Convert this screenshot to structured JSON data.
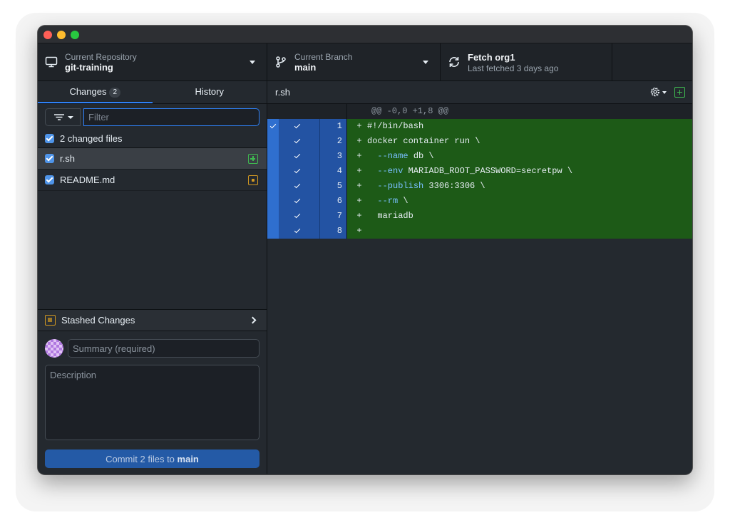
{
  "toolbar": {
    "repo_label": "Current Repository",
    "repo_value": "git-training",
    "branch_label": "Current Branch",
    "branch_value": "main",
    "fetch_label": "Fetch org1",
    "fetch_sub": "Last fetched 3 days ago"
  },
  "tabs": {
    "changes_label": "Changes",
    "changes_count": "2",
    "history_label": "History"
  },
  "filter": {
    "placeholder": "Filter"
  },
  "changes": {
    "summary": "2 changed files",
    "files": [
      {
        "name": "r.sh",
        "status": "added",
        "checked": true
      },
      {
        "name": "README.md",
        "status": "modified",
        "checked": true
      }
    ]
  },
  "stash": {
    "label": "Stashed Changes"
  },
  "commit": {
    "summary_placeholder": "Summary (required)",
    "description_placeholder": "Description",
    "button_prefix": "Commit 2 files to ",
    "button_branch": "main"
  },
  "diff": {
    "file_name": "r.sh",
    "hunk_header": "@@ -0,0 +1,8 @@",
    "lines": [
      {
        "num": "1",
        "sign": "+",
        "code": "#!/bin/bash"
      },
      {
        "num": "2",
        "sign": "+",
        "code": "docker container run \\"
      },
      {
        "num": "3",
        "sign": "+",
        "code": "  --name db \\"
      },
      {
        "num": "4",
        "sign": "+",
        "code": "  --env MARIADB_ROOT_PASSWORD=secretpw \\"
      },
      {
        "num": "5",
        "sign": "+",
        "code": "  --publish 3306:3306 \\"
      },
      {
        "num": "6",
        "sign": "+",
        "code": "  --rm \\"
      },
      {
        "num": "7",
        "sign": "+",
        "code": "  mariadb"
      },
      {
        "num": "8",
        "sign": "+",
        "code": ""
      }
    ]
  },
  "colors": {
    "accent": "#2f81f7",
    "added": "#3fb950",
    "modified": "#d29922",
    "diff_added_bg": "#1d5a17",
    "gutter_selected": "#2353a3"
  }
}
